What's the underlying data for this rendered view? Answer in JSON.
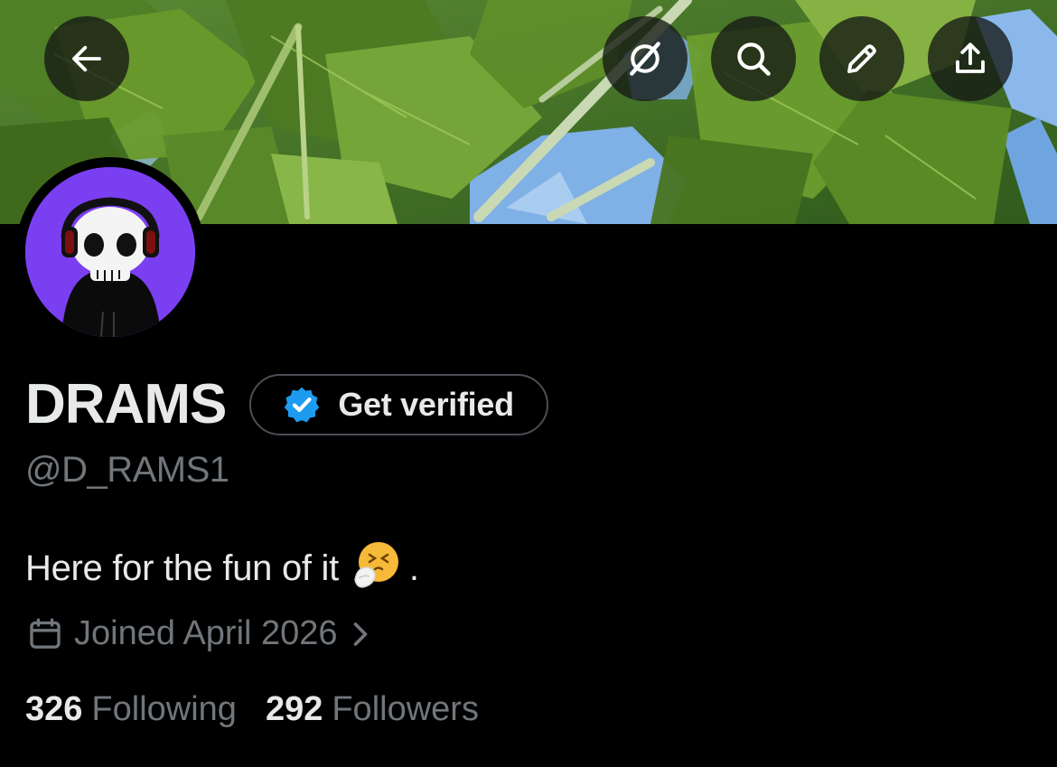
{
  "header": {
    "back_icon": "arrow-left-icon",
    "grok_icon": "grok-icon",
    "search_icon": "search-icon",
    "edit_icon": "pencil-icon",
    "share_icon": "share-icon"
  },
  "profile": {
    "display_name": "DRAMS",
    "handle": "@D_RAMS1",
    "get_verified_label": "Get verified",
    "bio_text": "Here for the fun of it",
    "bio_emoji": "sneezing-face-emoji",
    "bio_suffix": ".",
    "joined_text": "Joined April 2026",
    "following_count": "326",
    "following_label": "Following",
    "followers_count": "292",
    "followers_label": "Followers"
  },
  "colors": {
    "background": "#000000",
    "primary_text": "#e7e9ea",
    "secondary_text": "#71767b",
    "verified_blue": "#1d9bf0",
    "avatar_bg": "#7b3ff2",
    "button_border": "#4a4f55"
  }
}
